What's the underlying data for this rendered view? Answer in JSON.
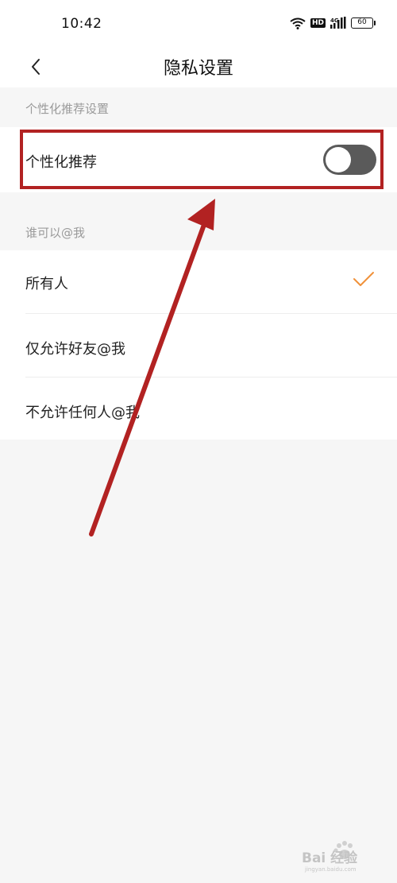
{
  "status_bar": {
    "time": "10:42",
    "network_badge": "HD",
    "cellular_label": "4G",
    "battery": "60",
    "icons": [
      "wifi-icon",
      "hd-badge",
      "cellular-signal-icon",
      "battery-icon"
    ]
  },
  "nav": {
    "back_icon": "chevron-left-icon",
    "title": "隐私设置"
  },
  "sections": {
    "personalization": {
      "header": "个性化推荐设置",
      "row_label": "个性化推荐",
      "toggle_on": false
    },
    "mentions": {
      "header": "谁可以@我",
      "options": [
        {
          "label": "所有人",
          "selected": true
        },
        {
          "label": "仅允许好友@我",
          "selected": false
        },
        {
          "label": "不允许任何人@我",
          "selected": false
        }
      ]
    }
  },
  "annotation": {
    "color": "#b22222"
  },
  "colors": {
    "background": "#f6f6f6",
    "check_accent": "#f0913a",
    "toggle_off": "#5a5a5a"
  },
  "watermark": {
    "text": "Bai 经验",
    "sub": "jingyan.baidu.com"
  }
}
